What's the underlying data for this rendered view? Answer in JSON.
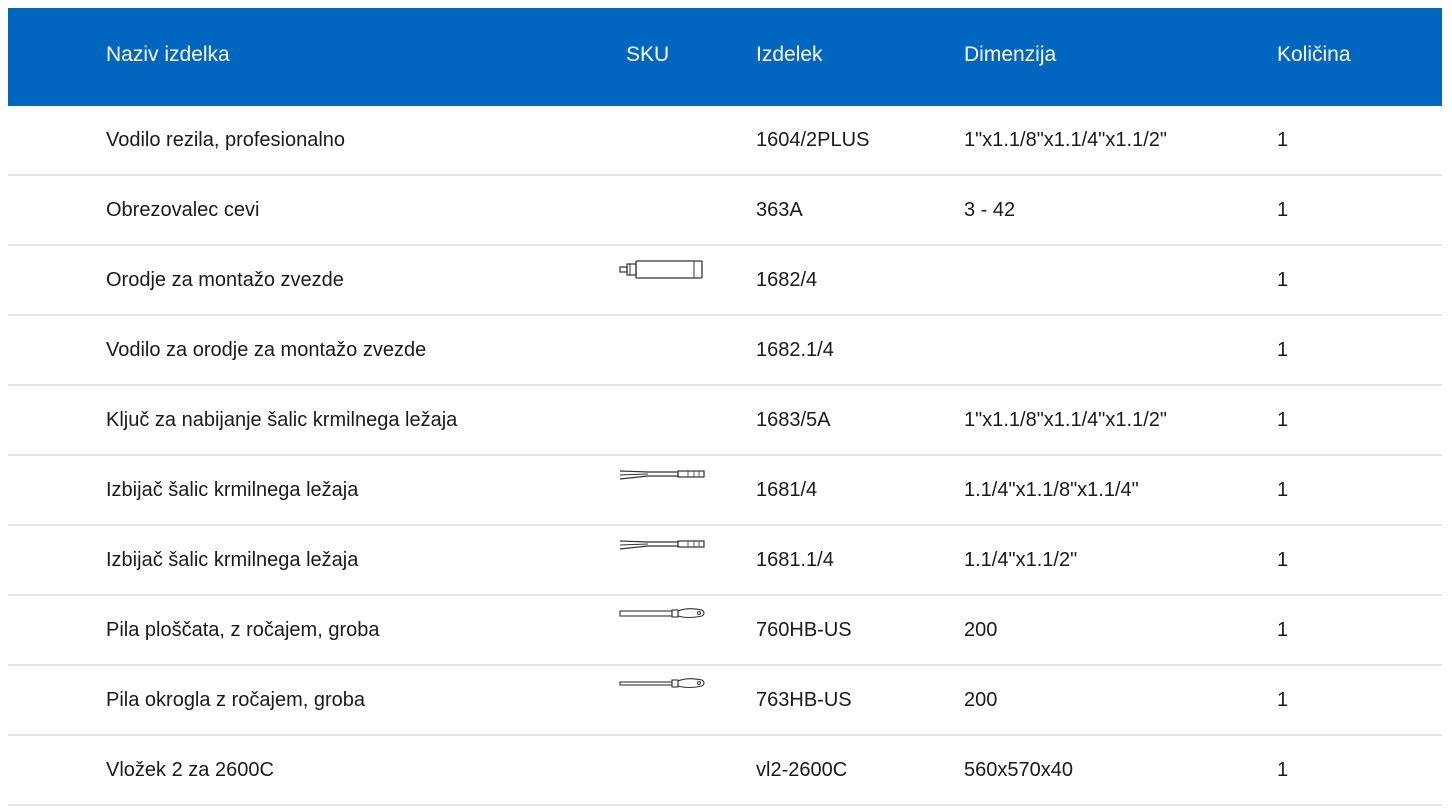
{
  "table": {
    "headers": {
      "name": "Naziv izdelka",
      "sku": "SKU",
      "item": "Izdelek",
      "dimension": "Dimenzija",
      "quantity": "Količina"
    },
    "rows": [
      {
        "name": "Vodilo rezila, profesionalno",
        "sku_icon": "",
        "item": "1604/2PLUS",
        "dimension": "1\"x1.1/8\"x1.1/4\"x1.1/2\"",
        "quantity": "1"
      },
      {
        "name": "Obrezovalec cevi",
        "sku_icon": "",
        "item": "363A",
        "dimension": "3 - 42",
        "quantity": "1"
      },
      {
        "name": "Orodje za montažo zvezde",
        "sku_icon": "star-nut-setter-tool-icon",
        "item": "1682/4",
        "dimension": "",
        "quantity": "1"
      },
      {
        "name": "Vodilo za orodje za montažo zvezde",
        "sku_icon": "",
        "item": "1682.1/4",
        "dimension": "",
        "quantity": "1"
      },
      {
        "name": "Ključ za nabijanje šalic krmilnega ležaja",
        "sku_icon": "",
        "item": "1683/5A",
        "dimension": "1\"x1.1/8\"x1.1/4\"x1.1/2\"",
        "quantity": "1"
      },
      {
        "name": "Izbijač šalic krmilnega ležaja",
        "sku_icon": "cup-remover-tool-icon",
        "item": "1681/4",
        "dimension": "1.1/4\"x1.1/8\"x1.1/4\"",
        "quantity": "1"
      },
      {
        "name": "Izbijač šalic krmilnega ležaja",
        "sku_icon": "cup-remover-tool-icon",
        "item": "1681.1/4",
        "dimension": "1.1/4\"x1.1/2\"",
        "quantity": "1"
      },
      {
        "name": "Pila ploščata, z ročajem, groba",
        "sku_icon": "flat-file-icon",
        "item": "760HB-US",
        "dimension": "200",
        "quantity": "1"
      },
      {
        "name": "Pila okrogla z ročajem, groba",
        "sku_icon": "round-file-icon",
        "item": "763HB-US",
        "dimension": "200",
        "quantity": "1"
      },
      {
        "name": "Vložek 2 za 2600C",
        "sku_icon": "",
        "item": "vl2-2600C",
        "dimension": "560x570x40",
        "quantity": "1"
      }
    ]
  },
  "colors": {
    "header_bg": "#0066bf",
    "header_text": "#ffffff",
    "row_divider": "#e6e6e6"
  }
}
